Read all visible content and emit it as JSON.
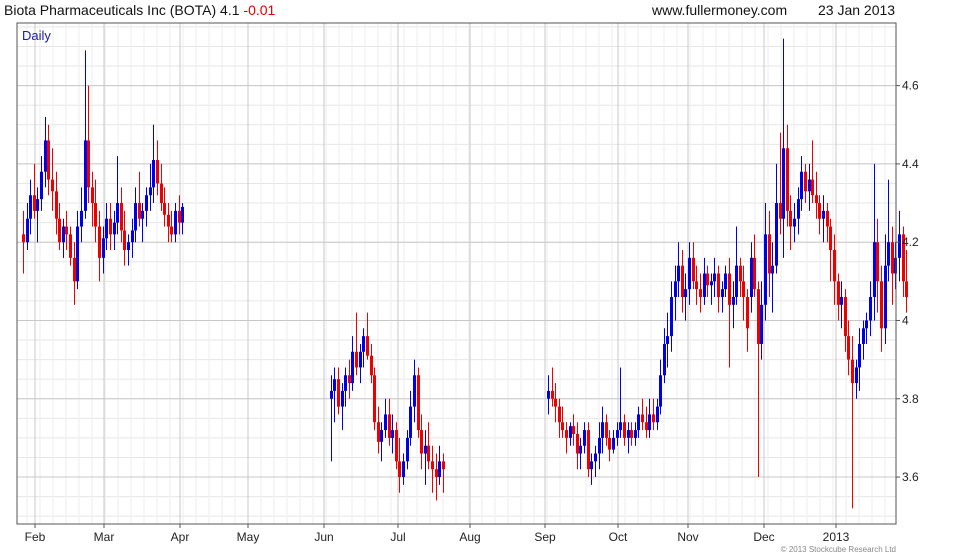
{
  "header": {
    "name": "Biota Pharmaceuticals Inc (BOTA)",
    "price": "4.1",
    "change": "-0.01",
    "site": "www.fullermoney.com",
    "date": "23 Jan 2013"
  },
  "copyright": "© 2013 Stockcube Research Ltd",
  "colors": {
    "up": "#0000e6",
    "down": "#ee0000",
    "grid": "#d8d8d8",
    "frame": "#555555",
    "label": "#1a1aa6"
  },
  "chart_data": {
    "type": "ohlc",
    "period_label": "Daily",
    "x_ticks": [
      "Feb",
      "Mar",
      "Apr",
      "May",
      "Jun",
      "Jul",
      "Aug",
      "Sep",
      "Oct",
      "Nov",
      "Dec",
      "2013"
    ],
    "y_ticks": [
      3.6,
      3.8,
      4,
      4.2,
      4.4,
      4.6
    ],
    "y_range": [
      3.48,
      4.76
    ],
    "grid": true,
    "segments": [
      {
        "start_day": 0,
        "bars": [
          [
            4.22,
            4.28,
            4.12,
            4.2
          ],
          [
            4.2,
            4.3,
            4.18,
            4.26
          ],
          [
            4.26,
            4.36,
            4.22,
            4.32
          ],
          [
            4.32,
            4.4,
            4.26,
            4.28
          ],
          [
            4.28,
            4.34,
            4.2,
            4.31
          ],
          [
            4.31,
            4.42,
            4.28,
            4.38
          ],
          [
            4.38,
            4.52,
            4.34,
            4.46
          ],
          [
            4.46,
            4.5,
            4.32,
            4.36
          ],
          [
            4.36,
            4.44,
            4.28,
            4.33
          ],
          [
            4.33,
            4.38,
            4.22,
            4.26
          ],
          [
            4.26,
            4.3,
            4.18,
            4.2
          ],
          [
            4.2,
            4.26,
            4.16,
            4.24
          ],
          [
            4.24,
            4.28,
            4.18,
            4.22
          ],
          [
            4.22,
            4.24,
            4.14,
            4.16
          ],
          [
            4.16,
            4.2,
            4.04,
            4.1
          ],
          [
            4.1,
            4.28,
            4.08,
            4.24
          ],
          [
            4.24,
            4.34,
            4.2,
            4.28
          ],
          [
            4.28,
            4.69,
            4.26,
            4.46
          ],
          [
            4.46,
            4.6,
            4.3,
            4.34
          ],
          [
            4.34,
            4.38,
            4.24,
            4.3
          ],
          [
            4.3,
            4.36,
            4.2,
            4.24
          ],
          [
            4.24,
            4.28,
            4.1,
            4.16
          ],
          [
            4.16,
            4.24,
            4.12,
            4.21
          ],
          [
            4.21,
            4.3,
            4.18,
            4.26
          ],
          [
            4.26,
            4.3,
            4.18,
            4.22
          ],
          [
            4.22,
            4.28,
            4.18,
            4.25
          ],
          [
            4.25,
            4.42,
            4.22,
            4.3
          ],
          [
            4.3,
            4.34,
            4.2,
            4.23
          ],
          [
            4.23,
            4.28,
            4.14,
            4.18
          ],
          [
            4.18,
            4.22,
            4.14,
            4.2
          ],
          [
            4.2,
            4.26,
            4.16,
            4.23
          ],
          [
            4.23,
            4.34,
            4.2,
            4.3
          ],
          [
            4.3,
            4.38,
            4.24,
            4.26
          ],
          [
            4.26,
            4.3,
            4.2,
            4.28
          ],
          [
            4.28,
            4.34,
            4.24,
            4.32
          ],
          [
            4.32,
            4.4,
            4.28,
            4.34
          ],
          [
            4.34,
            4.5,
            4.3,
            4.41
          ],
          [
            4.41,
            4.46,
            4.32,
            4.35
          ],
          [
            4.35,
            4.4,
            4.28,
            4.3
          ],
          [
            4.3,
            4.34,
            4.24,
            4.27
          ],
          [
            4.27,
            4.3,
            4.2,
            4.24
          ],
          [
            4.24,
            4.28,
            4.2,
            4.22
          ],
          [
            4.22,
            4.3,
            4.2,
            4.28
          ],
          [
            4.28,
            4.32,
            4.22,
            4.25
          ],
          [
            4.25,
            4.3,
            4.22,
            4.29
          ]
        ]
      },
      {
        "start_day": 85,
        "bars": [
          [
            3.8,
            3.86,
            3.64,
            3.82
          ],
          [
            3.82,
            3.88,
            3.74,
            3.85
          ],
          [
            3.85,
            3.88,
            3.76,
            3.78
          ],
          [
            3.78,
            3.84,
            3.72,
            3.82
          ],
          [
            3.82,
            3.88,
            3.78,
            3.86
          ],
          [
            3.86,
            3.9,
            3.8,
            3.84
          ],
          [
            3.84,
            3.96,
            3.82,
            3.92
          ],
          [
            3.92,
            4.02,
            3.86,
            3.88
          ],
          [
            3.88,
            3.94,
            3.84,
            3.92
          ],
          [
            3.92,
            3.98,
            3.88,
            3.96
          ],
          [
            3.96,
            4.02,
            3.9,
            3.91
          ],
          [
            3.91,
            3.94,
            3.84,
            3.86
          ],
          [
            3.86,
            3.88,
            3.72,
            3.74
          ],
          [
            3.74,
            3.78,
            3.66,
            3.69
          ],
          [
            3.69,
            3.74,
            3.64,
            3.72
          ],
          [
            3.72,
            3.8,
            3.7,
            3.76
          ],
          [
            3.76,
            3.8,
            3.68,
            3.7
          ],
          [
            3.7,
            3.76,
            3.66,
            3.72
          ],
          [
            3.72,
            3.74,
            3.62,
            3.64
          ],
          [
            3.64,
            3.7,
            3.56,
            3.6
          ],
          [
            3.6,
            3.66,
            3.58,
            3.64
          ],
          [
            3.64,
            3.72,
            3.62,
            3.7
          ],
          [
            3.7,
            3.82,
            3.68,
            3.78
          ],
          [
            3.78,
            3.9,
            3.74,
            3.86
          ],
          [
            3.86,
            3.88,
            3.7,
            3.72
          ],
          [
            3.72,
            3.76,
            3.62,
            3.66
          ],
          [
            3.66,
            3.72,
            3.58,
            3.68
          ],
          [
            3.68,
            3.74,
            3.62,
            3.64
          ],
          [
            3.64,
            3.68,
            3.56,
            3.62
          ],
          [
            3.62,
            3.66,
            3.54,
            3.6
          ],
          [
            3.6,
            3.68,
            3.58,
            3.64
          ],
          [
            3.64,
            3.66,
            3.56,
            3.62
          ]
        ]
      },
      {
        "start_day": 145,
        "bars": [
          [
            3.8,
            3.86,
            3.76,
            3.82
          ],
          [
            3.82,
            3.88,
            3.78,
            3.8
          ],
          [
            3.8,
            3.84,
            3.74,
            3.78
          ],
          [
            3.78,
            3.8,
            3.7,
            3.74
          ],
          [
            3.74,
            3.78,
            3.7,
            3.72
          ],
          [
            3.72,
            3.74,
            3.66,
            3.7
          ],
          [
            3.7,
            3.74,
            3.68,
            3.73
          ],
          [
            3.73,
            3.76,
            3.68,
            3.71
          ],
          [
            3.71,
            3.74,
            3.62,
            3.66
          ],
          [
            3.66,
            3.7,
            3.62,
            3.68
          ],
          [
            3.68,
            3.74,
            3.66,
            3.72
          ],
          [
            3.72,
            3.74,
            3.6,
            3.62
          ],
          [
            3.62,
            3.66,
            3.58,
            3.64
          ],
          [
            3.64,
            3.68,
            3.6,
            3.66
          ],
          [
            3.66,
            3.74,
            3.62,
            3.7
          ],
          [
            3.7,
            3.78,
            3.66,
            3.74
          ],
          [
            3.74,
            3.76,
            3.68,
            3.7
          ],
          [
            3.7,
            3.72,
            3.64,
            3.67
          ],
          [
            3.67,
            3.72,
            3.66,
            3.7
          ],
          [
            3.7,
            3.74,
            3.68,
            3.72
          ],
          [
            3.72,
            3.88,
            3.7,
            3.74
          ],
          [
            3.74,
            3.76,
            3.68,
            3.7
          ],
          [
            3.7,
            3.74,
            3.66,
            3.72
          ],
          [
            3.72,
            3.74,
            3.68,
            3.7
          ],
          [
            3.7,
            3.74,
            3.68,
            3.72
          ],
          [
            3.72,
            3.78,
            3.7,
            3.76
          ],
          [
            3.76,
            3.8,
            3.72,
            3.74
          ],
          [
            3.74,
            3.78,
            3.7,
            3.72
          ],
          [
            3.72,
            3.8,
            3.7,
            3.76
          ],
          [
            3.76,
            3.8,
            3.72,
            3.74
          ],
          [
            3.74,
            3.8,
            3.72,
            3.78
          ],
          [
            3.78,
            3.9,
            3.76,
            3.86
          ],
          [
            3.86,
            3.98,
            3.84,
            3.94
          ],
          [
            3.94,
            4.02,
            3.88,
            3.96
          ],
          [
            3.96,
            4.1,
            3.92,
            4.06
          ],
          [
            4.06,
            4.14,
            4.0,
            4.1
          ],
          [
            4.1,
            4.2,
            4.06,
            4.14
          ],
          [
            4.14,
            4.18,
            4.02,
            4.06
          ],
          [
            4.06,
            4.12,
            4.0,
            4.08
          ],
          [
            4.08,
            4.2,
            4.04,
            4.16
          ],
          [
            4.16,
            4.2,
            4.08,
            4.1
          ],
          [
            4.1,
            4.14,
            4.04,
            4.08
          ],
          [
            4.08,
            4.12,
            4.02,
            4.06
          ],
          [
            4.06,
            4.16,
            4.04,
            4.12
          ],
          [
            4.12,
            4.14,
            4.06,
            4.09
          ],
          [
            4.09,
            4.12,
            4.04,
            4.1
          ],
          [
            4.1,
            4.16,
            4.06,
            4.12
          ],
          [
            4.12,
            4.14,
            4.02,
            4.06
          ],
          [
            4.06,
            4.1,
            4.02,
            4.08
          ],
          [
            4.08,
            4.14,
            4.06,
            4.12
          ],
          [
            4.12,
            4.16,
            3.88,
            4.04
          ],
          [
            4.04,
            4.1,
            3.98,
            4.06
          ],
          [
            4.06,
            4.24,
            4.04,
            4.14
          ],
          [
            4.14,
            4.16,
            4.06,
            4.1
          ],
          [
            4.1,
            4.14,
            4.0,
            4.06
          ],
          [
            4.06,
            4.08,
            3.92,
            3.98
          ],
          [
            4.06,
            4.2,
            4.02,
            4.16
          ],
          [
            4.16,
            4.22,
            4.06,
            4.08
          ],
          [
            4.08,
            4.1,
            3.6,
            3.94
          ],
          [
            3.94,
            4.1,
            3.9,
            4.04
          ],
          [
            4.04,
            4.3,
            4.0,
            4.22
          ],
          [
            4.22,
            4.28,
            4.06,
            4.12
          ],
          [
            4.12,
            4.2,
            4.02,
            4.14
          ],
          [
            4.14,
            4.4,
            4.12,
            4.3
          ],
          [
            4.3,
            4.48,
            4.22,
            4.26
          ],
          [
            4.26,
            4.72,
            4.16,
            4.44
          ],
          [
            4.44,
            4.5,
            4.24,
            4.28
          ],
          [
            4.28,
            4.32,
            4.18,
            4.24
          ],
          [
            4.24,
            4.3,
            4.2,
            4.26
          ],
          [
            4.26,
            4.34,
            4.22,
            4.31
          ],
          [
            4.31,
            4.42,
            4.28,
            4.38
          ],
          [
            4.38,
            4.4,
            4.3,
            4.33
          ],
          [
            4.33,
            4.4,
            4.28,
            4.36
          ],
          [
            4.36,
            4.46,
            4.3,
            4.32
          ],
          [
            4.32,
            4.38,
            4.26,
            4.3
          ],
          [
            4.3,
            4.32,
            4.22,
            4.26
          ],
          [
            4.26,
            4.32,
            4.2,
            4.28
          ],
          [
            4.28,
            4.3,
            4.2,
            4.24
          ],
          [
            4.24,
            4.26,
            4.1,
            4.18
          ],
          [
            4.18,
            4.22,
            4.04,
            4.1
          ],
          [
            4.1,
            4.12,
            4.0,
            4.04
          ],
          [
            4.04,
            4.1,
            3.98,
            4.06
          ],
          [
            4.06,
            4.08,
            3.92,
            3.96
          ],
          [
            3.96,
            4.0,
            3.86,
            3.9
          ],
          [
            3.9,
            3.96,
            3.52,
            3.84
          ],
          [
            3.84,
            3.9,
            3.8,
            3.88
          ],
          [
            3.88,
            3.98,
            3.82,
            3.94
          ],
          [
            3.94,
            4.0,
            3.9,
            3.98
          ],
          [
            3.98,
            4.02,
            3.94,
            4.0
          ],
          [
            4.0,
            4.1,
            3.96,
            4.06
          ],
          [
            4.06,
            4.4,
            4.0,
            4.2
          ],
          [
            4.2,
            4.26,
            4.02,
            4.1
          ],
          [
            4.1,
            4.14,
            3.92,
            3.98
          ],
          [
            3.98,
            4.22,
            3.94,
            4.14
          ],
          [
            4.14,
            4.36,
            4.1,
            4.2
          ],
          [
            4.2,
            4.24,
            4.04,
            4.12
          ],
          [
            4.12,
            4.2,
            4.08,
            4.16
          ],
          [
            4.16,
            4.28,
            4.1,
            4.22
          ],
          [
            4.22,
            4.24,
            4.06,
            4.1
          ],
          [
            4.1,
            4.18,
            4.02,
            4.06
          ]
        ]
      }
    ]
  }
}
